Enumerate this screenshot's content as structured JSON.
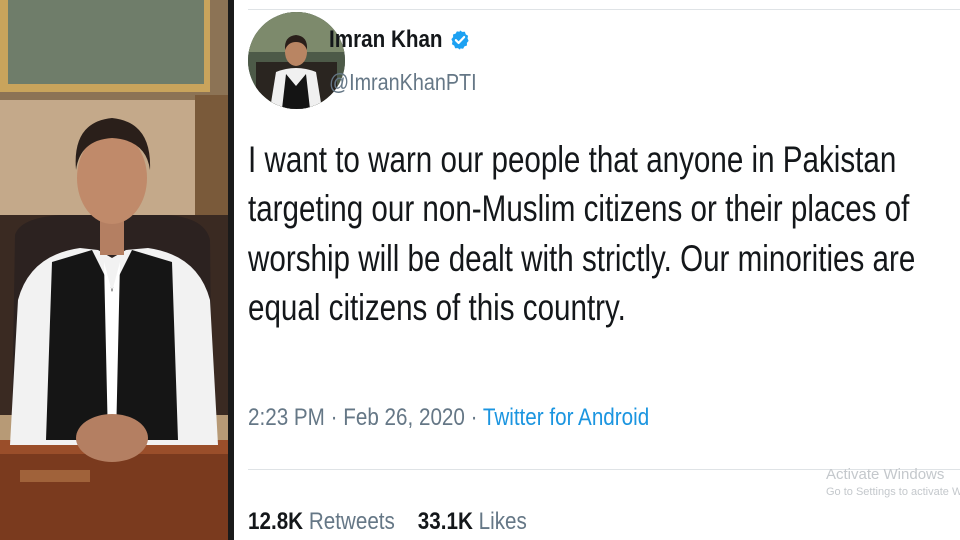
{
  "profile": {
    "name": "Imran Khan",
    "handle": "@ImranKhanPTI",
    "verified": true
  },
  "tweet": {
    "lines": [
      "I want to warn our people that anyone in Pakistan",
      "targeting our non-Muslim citizens or their places of",
      "worship will be dealt with strictly. Our minorities are",
      "equal citizens of this country."
    ],
    "time": "2:23 PM",
    "separator": "·",
    "date": "Feb 26, 2020",
    "source": "Twitter for Android"
  },
  "stats": {
    "retweets_count": "12.8K",
    "retweets_label": "Retweets",
    "likes_count": "33.1K",
    "likes_label": "Likes"
  },
  "watermark": {
    "line1": "Activate Windows",
    "line2": "Go to Settings to activate Windows."
  },
  "colors": {
    "verified": "#1da1f2",
    "link": "#1b95e0",
    "text": "#14171a",
    "secondary": "#657786"
  }
}
